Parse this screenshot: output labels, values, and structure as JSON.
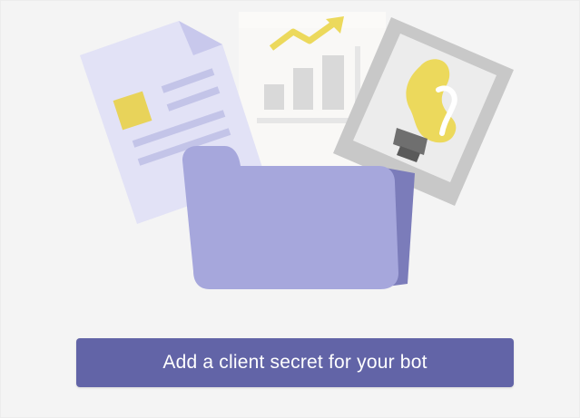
{
  "cta": {
    "label": "Add a client secret for your bot"
  },
  "illustration": {
    "icons": [
      "document-icon",
      "bar-chart-icon",
      "lightbulb-photo-icon",
      "folder-icon"
    ]
  },
  "colors": {
    "background": "#f4f4f4",
    "button": "#6264a7",
    "button_text": "#ffffff",
    "folder": "#a6a7dc",
    "folder_back": "#8b8cc7",
    "document": "#e2e2f6",
    "accent_yellow": "#e8d35a"
  }
}
